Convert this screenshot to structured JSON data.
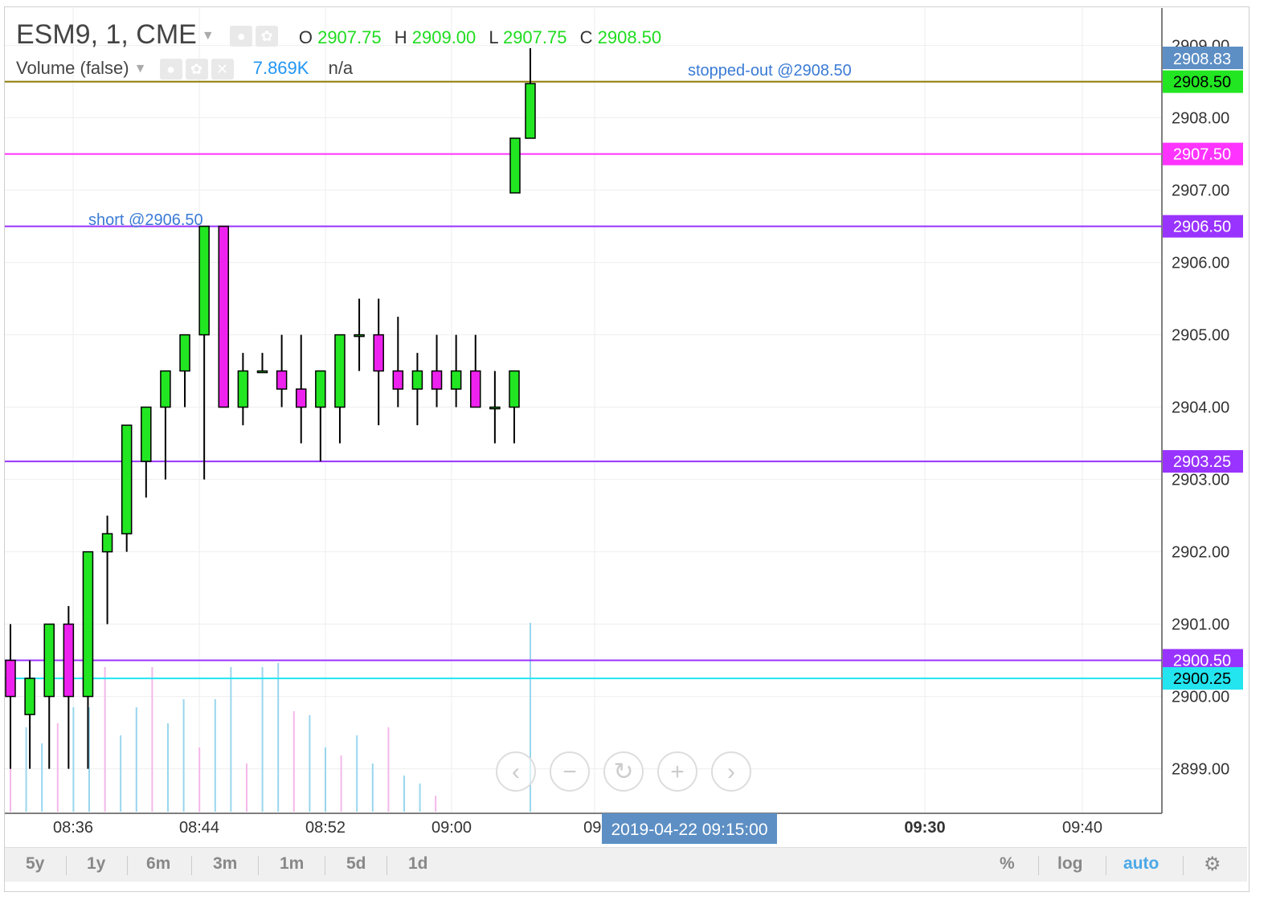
{
  "legend": {
    "symbol": "ESM9, 1, CME",
    "o_label": "O",
    "o_value": "2907.75",
    "h_label": "H",
    "h_value": "2909.00",
    "l_label": "L",
    "l_value": "2907.75",
    "c_label": "C",
    "c_value": "2908.50",
    "volume_label": "Volume (false)",
    "volume_value": "7.869K",
    "volume_na": "n/a"
  },
  "annotations": {
    "short_text": "short @2906.50",
    "stopped_text": "stopped-out @2908.50"
  },
  "crosshair_time": "2019-04-22 09:15:00",
  "range_buttons": [
    "5y",
    "1y",
    "6m",
    "3m",
    "1m",
    "5d",
    "1d"
  ],
  "right_buttons": {
    "percent": "%",
    "log": "log",
    "auto": "auto"
  },
  "colors": {
    "up": "#22e622",
    "down": "#ee22ee",
    "axis_text": "#333333",
    "grid": "#eeeeee",
    "vol_up": "#99d6ee",
    "vol_down": "#f4b8ea"
  },
  "chart_data": {
    "type": "candlestick",
    "ylim": [
      2898.5,
      2909.0
    ],
    "y_ticks": [
      "2899.00",
      "2900.00",
      "2901.00",
      "2902.00",
      "2903.00",
      "2904.00",
      "2905.00",
      "2906.00",
      "2907.00",
      "2908.00",
      "2909.00"
    ],
    "x_tick_labels": [
      "08:36",
      "08:44",
      "08:52",
      "09:00",
      "09:",
      "09:30",
      "09:40"
    ],
    "x_tick_bold": [
      false,
      false,
      false,
      false,
      false,
      true,
      false
    ],
    "candles": [
      {
        "o": 2900.5,
        "h": 2901.0,
        "l": 2899.0,
        "c": 2900.0
      },
      {
        "o": 2899.75,
        "h": 2900.5,
        "l": 2899.0,
        "c": 2900.25
      },
      {
        "o": 2900.0,
        "h": 2901.0,
        "l": 2899.0,
        "c": 2901.0
      },
      {
        "o": 2901.0,
        "h": 2901.25,
        "l": 2899.0,
        "c": 2900.0
      },
      {
        "o": 2900.0,
        "h": 2901.5,
        "l": 2899.0,
        "c": 2902.0
      },
      {
        "o": 2902.0,
        "h": 2902.5,
        "l": 2901.0,
        "c": 2902.25
      },
      {
        "o": 2902.25,
        "h": 2903.5,
        "l": 2902.0,
        "c": 2903.75
      },
      {
        "o": 2903.25,
        "h": 2903.75,
        "l": 2902.75,
        "c": 2904.0
      },
      {
        "o": 2904.0,
        "h": 2904.5,
        "l": 2903.0,
        "c": 2904.5
      },
      {
        "o": 2904.5,
        "h": 2905.0,
        "l": 2904.0,
        "c": 2905.0
      },
      {
        "o": 2905.0,
        "h": 2906.0,
        "l": 2903.0,
        "c": 2906.5
      },
      {
        "o": 2906.5,
        "h": 2906.5,
        "l": 2905.0,
        "c": 2904.0
      },
      {
        "o": 2904.0,
        "h": 2904.75,
        "l": 2903.75,
        "c": 2904.5
      },
      {
        "o": 2904.5,
        "h": 2904.75,
        "l": 2904.5,
        "c": 2904.5
      },
      {
        "o": 2904.5,
        "h": 2905.0,
        "l": 2904.0,
        "c": 2904.25
      },
      {
        "o": 2904.25,
        "h": 2905.0,
        "l": 2903.5,
        "c": 2904.0
      },
      {
        "o": 2904.0,
        "h": 2904.25,
        "l": 2903.25,
        "c": 2904.5
      },
      {
        "o": 2904.0,
        "h": 2904.5,
        "l": 2903.5,
        "c": 2905.0
      },
      {
        "o": 2905.0,
        "h": 2905.5,
        "l": 2904.5,
        "c": 2905.0
      },
      {
        "o": 2905.0,
        "h": 2905.5,
        "l": 2903.75,
        "c": 2904.5
      },
      {
        "o": 2904.5,
        "h": 2905.25,
        "l": 2904.0,
        "c": 2904.25
      },
      {
        "o": 2904.25,
        "h": 2904.75,
        "l": 2903.75,
        "c": 2904.5
      },
      {
        "o": 2904.5,
        "h": 2905.0,
        "l": 2904.0,
        "c": 2904.25
      },
      {
        "o": 2904.25,
        "h": 2905.0,
        "l": 2904.0,
        "c": 2904.5
      },
      {
        "o": 2904.5,
        "h": 2905.0,
        "l": 2904.25,
        "c": 2904.0
      },
      {
        "o": 2904.0,
        "h": 2904.5,
        "l": 2903.5,
        "c": 2904.0
      },
      {
        "o": 2904.0,
        "h": 2904.5,
        "l": 2903.5,
        "c": 2904.5
      }
    ],
    "horizontal_lines": [
      {
        "price": "2908.50",
        "color": "#8a7a00",
        "label_bg": "#22e622",
        "label_fg": "#000000"
      },
      {
        "price": "2907.50",
        "color": "#ff33ff",
        "label_bg": "#ff33ff",
        "label_fg": "#ffffff"
      },
      {
        "price": "2906.50",
        "color": "#9933ff",
        "label_bg": "#9933ff",
        "label_fg": "#ffffff"
      },
      {
        "price": "2903.25",
        "color": "#9933ff",
        "label_bg": "#9933ff",
        "label_fg": "#ffffff"
      },
      {
        "price": "2900.50",
        "color": "#9933ff",
        "label_bg": "#9933ff",
        "label_fg": "#ffffff"
      },
      {
        "price": "2900.25",
        "color": "#22e5f0",
        "label_bg": "#22e5f0",
        "label_fg": "#000000"
      }
    ],
    "last_price_tag": {
      "price": "2908.83",
      "bg": "#5d8fc4",
      "fg": "#ffffff"
    }
  }
}
